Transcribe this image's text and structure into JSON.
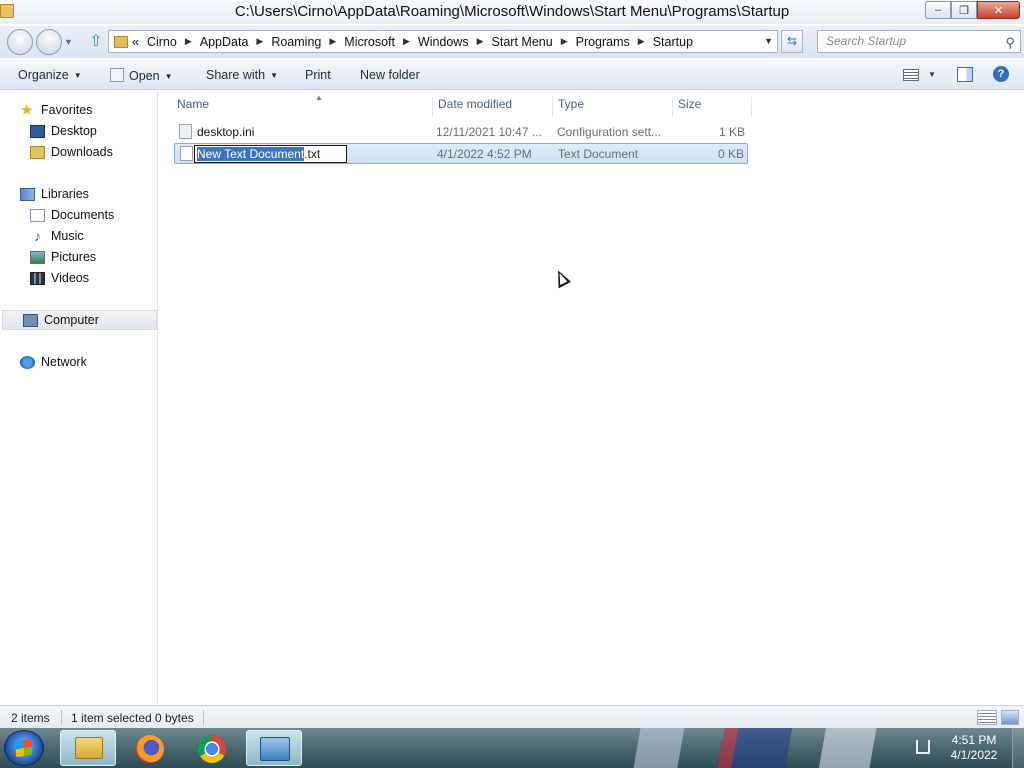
{
  "window": {
    "title": "C:\\Users\\Cirno\\AppData\\Roaming\\Microsoft\\Windows\\Start Menu\\Programs\\Startup",
    "controls": {
      "minimize": "–",
      "maximize": "❐",
      "close": "✕"
    }
  },
  "address": {
    "overflow": "«",
    "breadcrumbs": [
      "Cirno",
      "AppData",
      "Roaming",
      "Microsoft",
      "Windows",
      "Start Menu",
      "Programs",
      "Startup"
    ],
    "search_placeholder": "Search Startup"
  },
  "toolbar": {
    "organize": "Organize",
    "open": "Open",
    "share_with": "Share with",
    "print": "Print",
    "new_folder": "New folder"
  },
  "nav": {
    "favorites": "Favorites",
    "desktop": "Desktop",
    "downloads": "Downloads",
    "libraries": "Libraries",
    "documents": "Documents",
    "music": "Music",
    "pictures": "Pictures",
    "videos": "Videos",
    "computer": "Computer",
    "network": "Network"
  },
  "columns": {
    "name": "Name",
    "date_modified": "Date modified",
    "type": "Type",
    "size": "Size"
  },
  "files": [
    {
      "name": "desktop.ini",
      "date": "12/11/2021 10:47 ...",
      "type": "Configuration sett...",
      "size": "1 KB"
    },
    {
      "name_selected_part": "New Text Document",
      "name_ext": ".txt",
      "date": "4/1/2022 4:52 PM",
      "type": "Text Document",
      "size": "0 KB"
    }
  ],
  "status": {
    "items": "2 items",
    "selected": "1 item selected",
    "bytes": "0 bytes"
  },
  "taskbar": {
    "time": "4:51 PM",
    "date": "4/1/2022"
  }
}
